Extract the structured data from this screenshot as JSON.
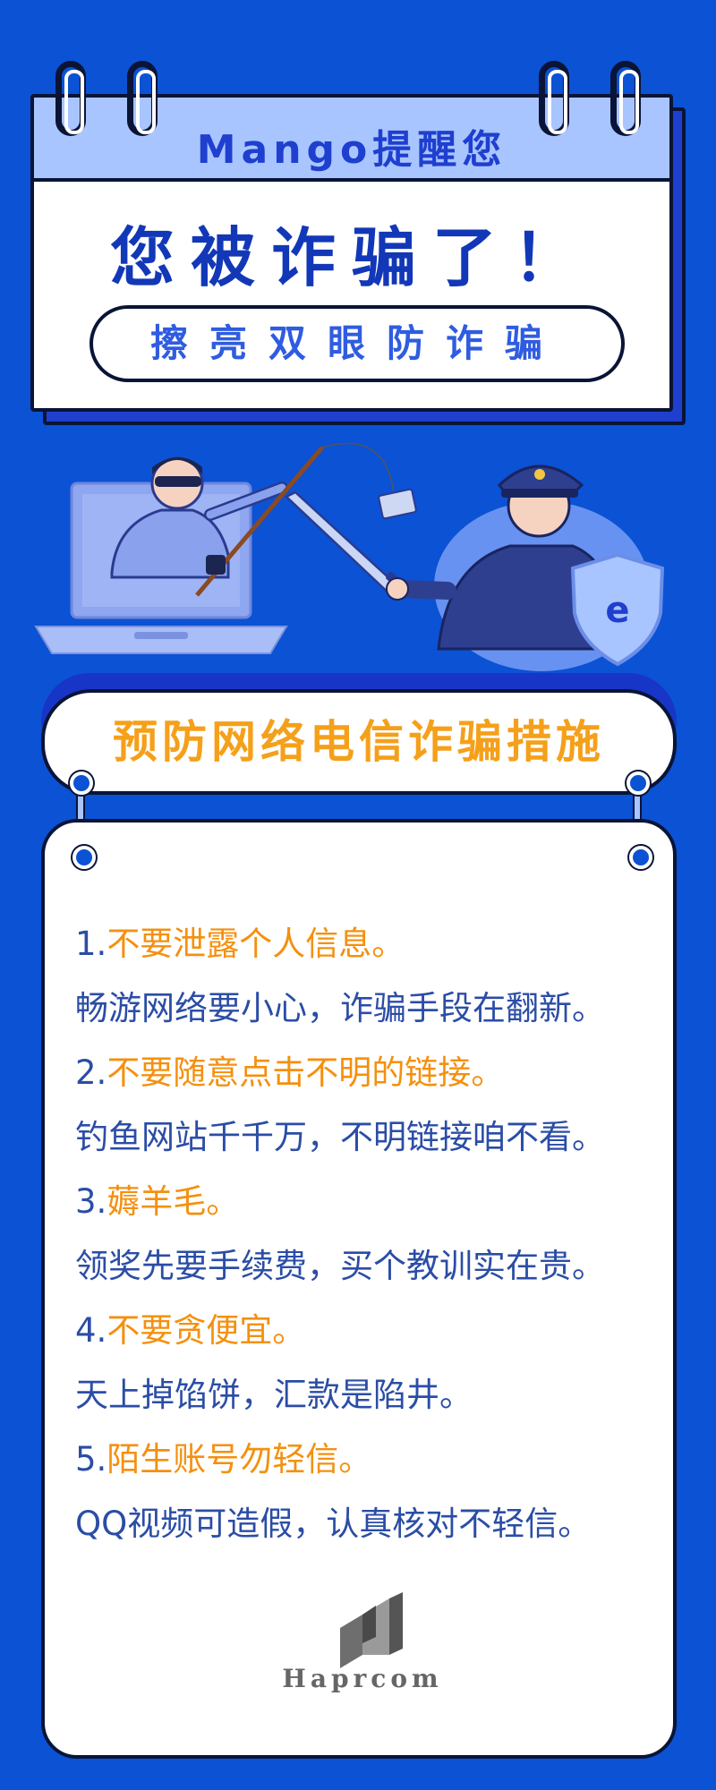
{
  "header": {
    "remind": "Mango提醒您",
    "title": "您被诈骗了！",
    "slogan": "擦亮双眼防诈骗"
  },
  "measures": {
    "title": "预防网络电信诈骗措施",
    "items": [
      {
        "num": "1.",
        "heading": "不要泄露个人信息。",
        "desc": "畅游网络要小心，诈骗手段在翻新。"
      },
      {
        "num": "2.",
        "heading": "不要随意点击不明的链接。",
        "desc": "钓鱼网站千千万，不明链接咱不看。"
      },
      {
        "num": "3.",
        "heading": "薅羊毛。",
        "desc": "领奖先要手续费，买个教训实在贵。"
      },
      {
        "num": "4.",
        "heading": "不要贪便宜。",
        "desc": "天上掉馅饼，汇款是陷井。"
      },
      {
        "num": "5.",
        "heading": "陌生账号勿轻信。",
        "desc": "QQ视频可造假，认真核对不轻信。"
      }
    ]
  },
  "logo": {
    "text": "Haprcom"
  },
  "colors": {
    "background": "#0b52d4",
    "accent_orange": "#f4900f",
    "text_blue": "#2b4da6",
    "header_light": "#a9c5ff"
  },
  "icons": [
    "binder-ring-icon",
    "hacker-illustration",
    "police-officer-illustration",
    "shield-e-icon",
    "haprcom-logo-icon"
  ]
}
